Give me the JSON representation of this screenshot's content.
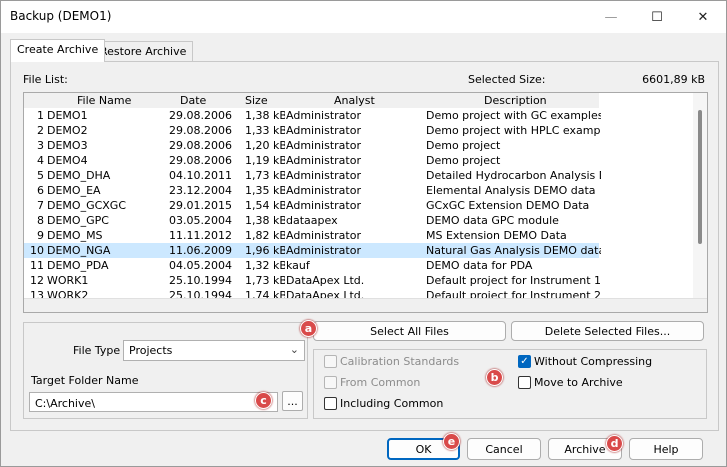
{
  "window": {
    "title": "Backup (DEMO1)",
    "controls": {
      "minimize": "—",
      "maximize": "☐",
      "close": "✕"
    }
  },
  "tabs": [
    {
      "label": "Create Archive",
      "active": true
    },
    {
      "label": "Restore Archive",
      "active": false
    }
  ],
  "file_list": {
    "label": "File List:",
    "selected_size_label": "Selected Size:",
    "selected_size_value": "6601,89 kB",
    "columns": [
      "File Name",
      "Date",
      "Size",
      "Analyst",
      "Description"
    ],
    "rows": [
      {
        "num": "1",
        "name": "DEMO1",
        "date": "29.08.2006",
        "size": "1,38 kB",
        "analyst": "Administrator",
        "desc": "Demo project with GC examples"
      },
      {
        "num": "2",
        "name": "DEMO2",
        "date": "29.08.2006",
        "size": "1,33 kB",
        "analyst": "Administrator",
        "desc": "Demo project with HPLC examples"
      },
      {
        "num": "3",
        "name": "DEMO3",
        "date": "29.08.2006",
        "size": "1,20 kB",
        "analyst": "Administrator",
        "desc": "Demo project"
      },
      {
        "num": "4",
        "name": "DEMO4",
        "date": "29.08.2006",
        "size": "1,19 kB",
        "analyst": "Administrator",
        "desc": "Demo project"
      },
      {
        "num": "5",
        "name": "DEMO_DHA",
        "date": "04.10.2011",
        "size": "1,73 kB",
        "analyst": "Administrator",
        "desc": "Detailed Hydrocarbon Analysis DEM"
      },
      {
        "num": "6",
        "name": "DEMO_EA",
        "date": "23.12.2004",
        "size": "1,35 kB",
        "analyst": "Administrator",
        "desc": "Elemental Analysis DEMO data"
      },
      {
        "num": "7",
        "name": "DEMO_GCXGC",
        "date": "29.01.2015",
        "size": "1,54 kB",
        "analyst": "Administrator",
        "desc": "GCxGC Extension DEMO Data"
      },
      {
        "num": "8",
        "name": "DEMO_GPC",
        "date": "03.05.2004",
        "size": "1,38 kB",
        "analyst": "dataapex",
        "desc": "DEMO data GPC module"
      },
      {
        "num": "9",
        "name": "DEMO_MS",
        "date": "11.11.2012",
        "size": "1,82 kB",
        "analyst": "Administrator",
        "desc": "MS Extension DEMO Data"
      },
      {
        "num": "10",
        "name": "DEMO_NGA",
        "date": "11.06.2009",
        "size": "1,96 kB",
        "analyst": "Administrator",
        "desc": "Natural Gas Analysis DEMO data",
        "selected": true
      },
      {
        "num": "11",
        "name": "DEMO_PDA",
        "date": "04.05.2004",
        "size": "1,32 kB",
        "analyst": "kauf",
        "desc": "DEMO data for PDA"
      },
      {
        "num": "12",
        "name": "WORK1",
        "date": "25.10.1994",
        "size": "1,73 kB",
        "analyst": "DataApex Ltd.",
        "desc": "Default project for Instrument 1"
      },
      {
        "num": "13",
        "name": "WORK2",
        "date": "25.10.1994",
        "size": "1,74 kB",
        "analyst": "DataApex Ltd.",
        "desc": "Default project for Instrument 2"
      }
    ]
  },
  "options": {
    "file_type_label": "File Type",
    "file_type_value": "Projects",
    "target_folder_label": "Target Folder Name",
    "target_folder_value": "C:\\Archive\\",
    "browse_label": "...",
    "select_all_label": "Select All Files",
    "delete_selected_label": "Delete Selected Files...",
    "calibration_standards": {
      "label": "Calibration Standards",
      "checked": false,
      "disabled": true
    },
    "from_common": {
      "label": "From Common",
      "checked": false,
      "disabled": true
    },
    "including_common": {
      "label": "Including Common",
      "checked": false,
      "disabled": false
    },
    "without_compressing": {
      "label": "Without Compressing",
      "checked": true,
      "disabled": false
    },
    "move_to_archive": {
      "label": "Move to Archive",
      "checked": false,
      "disabled": false
    }
  },
  "buttons": {
    "ok": "OK",
    "cancel": "Cancel",
    "archive": "Archive",
    "help": "Help"
  },
  "markers": {
    "a": "a",
    "b": "b",
    "c": "c",
    "d": "d",
    "e": "e"
  },
  "colors": {
    "accent": "#0067c0",
    "selection": "#cce8ff",
    "marker": "#d94a4a"
  }
}
